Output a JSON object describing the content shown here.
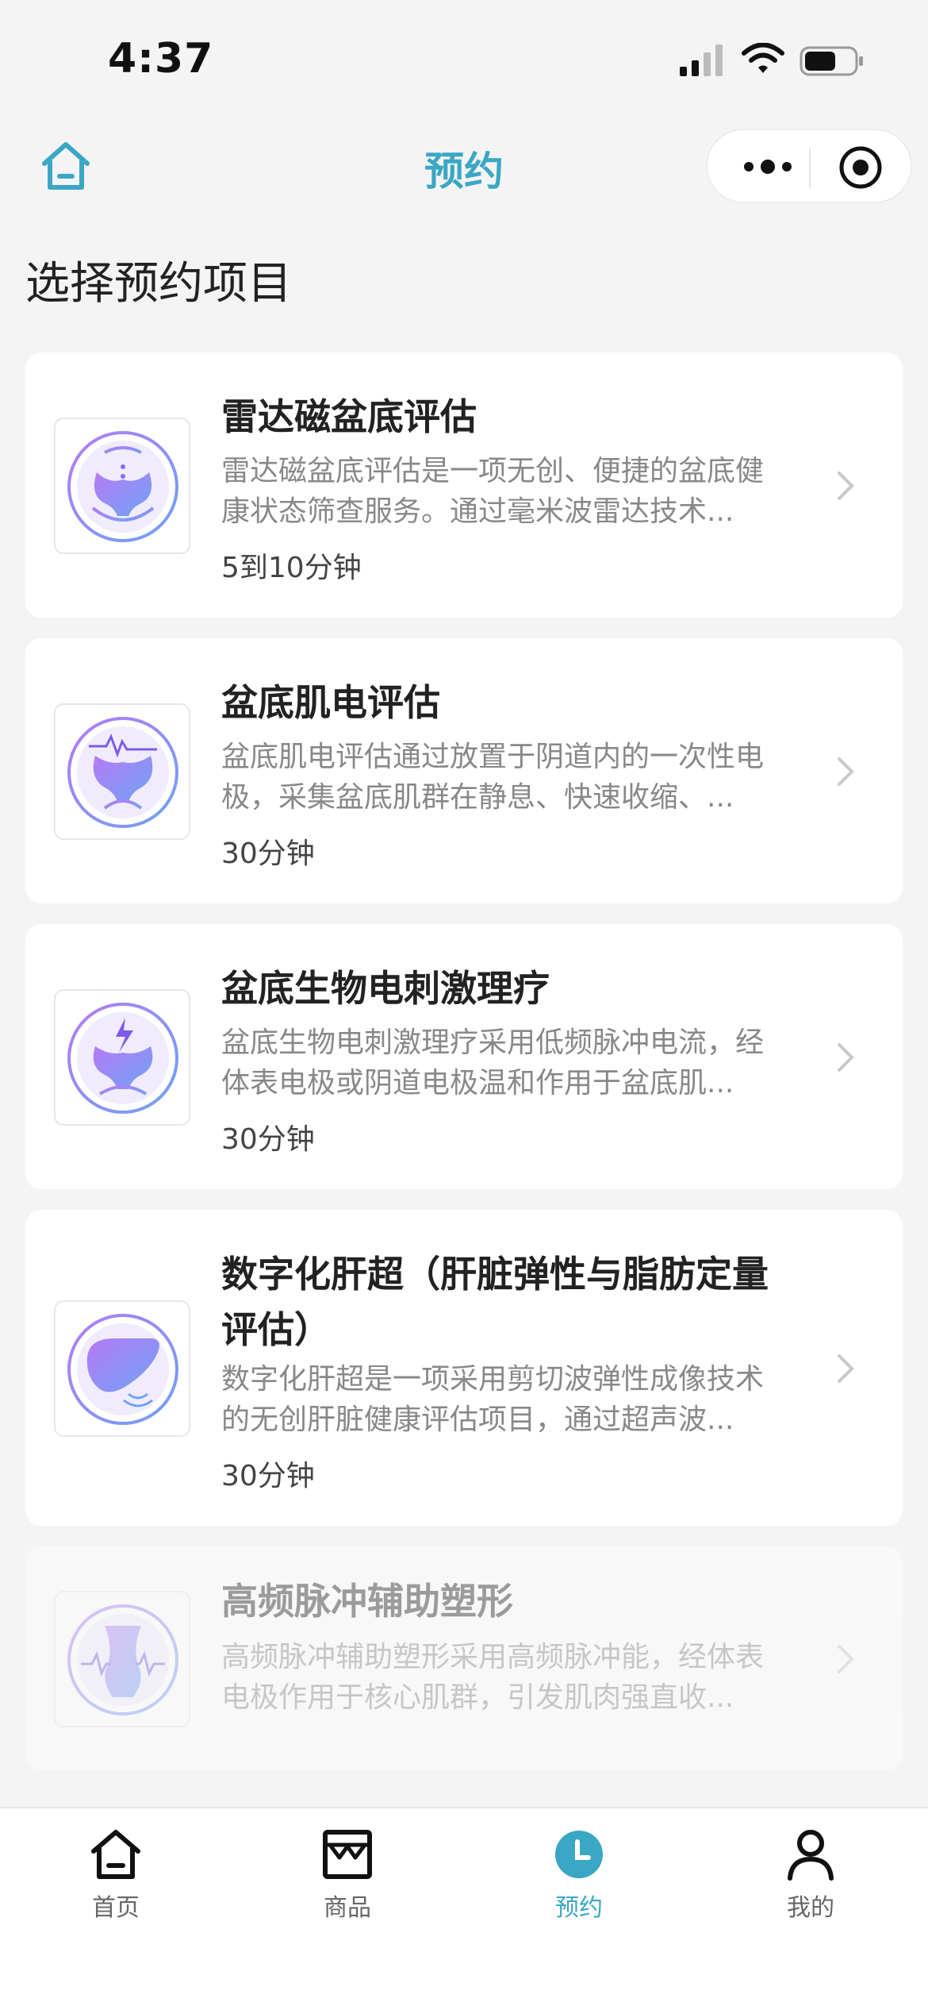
{
  "status_bar": {
    "time": "4:37"
  },
  "nav": {
    "title": "预约"
  },
  "section_title": "选择预约项目",
  "services": [
    {
      "name_lines": [
        "雷达磁盆底评估"
      ],
      "desc_lines": [
        "雷达磁盆底评估是一项无创、便捷的盆底健",
        "康状态筛查服务。通过毫米波雷达技术..."
      ],
      "duration": "5到10分钟",
      "icon": "radar-pelvis-icon",
      "enabled": true
    },
    {
      "name_lines": [
        "盆底肌电评估"
      ],
      "desc_lines": [
        "盆底肌电评估通过放置于阴道内的一次性电",
        "极，采集盆底肌群在静息、快速收缩、..."
      ],
      "duration": "30分钟",
      "icon": "emg-pelvis-icon",
      "enabled": true
    },
    {
      "name_lines": [
        "盆底生物电刺激理疗"
      ],
      "desc_lines": [
        "盆底生物电刺激理疗采用低频脉冲电流，经",
        "体表电极或阴道电极温和作用于盆底肌..."
      ],
      "duration": "30分钟",
      "icon": "electrostim-pelvis-icon",
      "enabled": true
    },
    {
      "name_lines": [
        "数字化肝超（肝脏弹性与脂肪定量",
        "评估）"
      ],
      "desc_lines": [
        "数字化肝超是一项采用剪切波弹性成像技术",
        "的无创肝脏健康评估项目，通过超声波..."
      ],
      "duration": "30分钟",
      "icon": "liver-ultrasound-icon",
      "enabled": true
    },
    {
      "name_lines": [
        "高频脉冲辅助塑形"
      ],
      "desc_lines": [
        "高频脉冲辅助塑形采用高频脉冲能，经体表",
        "电极作用于核心肌群，引发肌肉强直收..."
      ],
      "duration": "",
      "icon": "body-shaping-icon",
      "enabled": false
    }
  ],
  "tabs": [
    {
      "label": "首页",
      "icon": "home-icon",
      "active": false
    },
    {
      "label": "商品",
      "icon": "shop-icon",
      "active": false
    },
    {
      "label": "预约",
      "icon": "clock-icon",
      "active": true
    },
    {
      "label": "我的",
      "icon": "user-icon",
      "active": false
    }
  ],
  "colors": {
    "accent": "#3aa7c4",
    "icon_purple": "#9b6cf0",
    "icon_blue": "#6fa3f5"
  }
}
